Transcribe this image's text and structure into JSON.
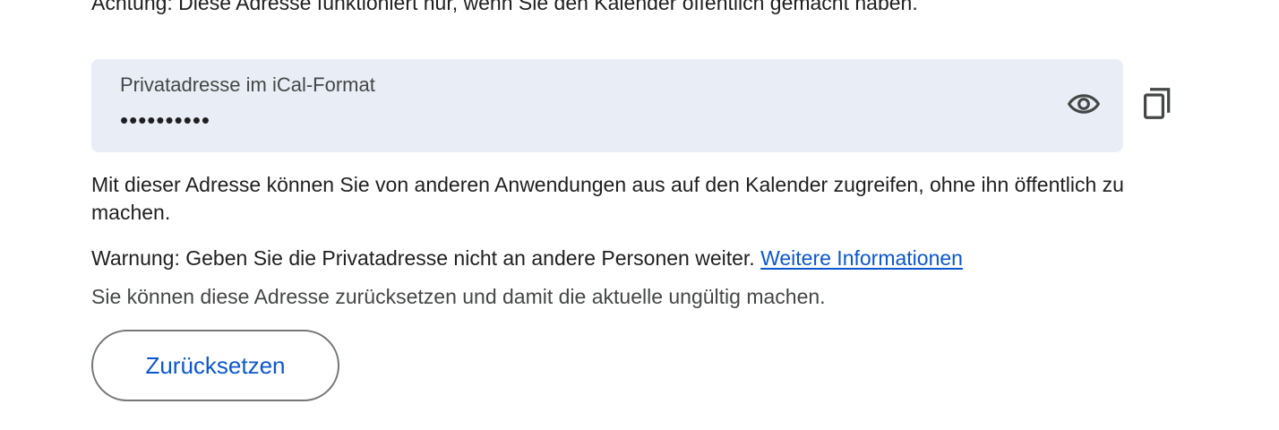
{
  "top_note": "Achtung: Diese Adresse funktioniert nur, wenn Sie den Kalender öffentlich gemacht haben.",
  "address_field": {
    "label": "Privatadresse im iCal-Format",
    "value": "••••••••••",
    "show_icon": "eye-icon",
    "copy_icon": "copy-icon"
  },
  "description": "Mit dieser Adresse können Sie von anderen Anwendungen aus auf den Kalender zugreifen, ohne ihn öffentlich zu machen.",
  "warning": {
    "text": "Warnung: Geben Sie die Privatadresse nicht an andere Personen weiter. ",
    "link_label": "Weitere Informationen"
  },
  "reset_note": "Sie können diese Adresse zurücksetzen und damit die aktuelle ungültig machen.",
  "reset_button_label": "Zurücksetzen",
  "colors": {
    "field_background": "#e9eef6",
    "link": "#0b57d0",
    "button_border": "#747775",
    "secondary_text": "#444746"
  }
}
